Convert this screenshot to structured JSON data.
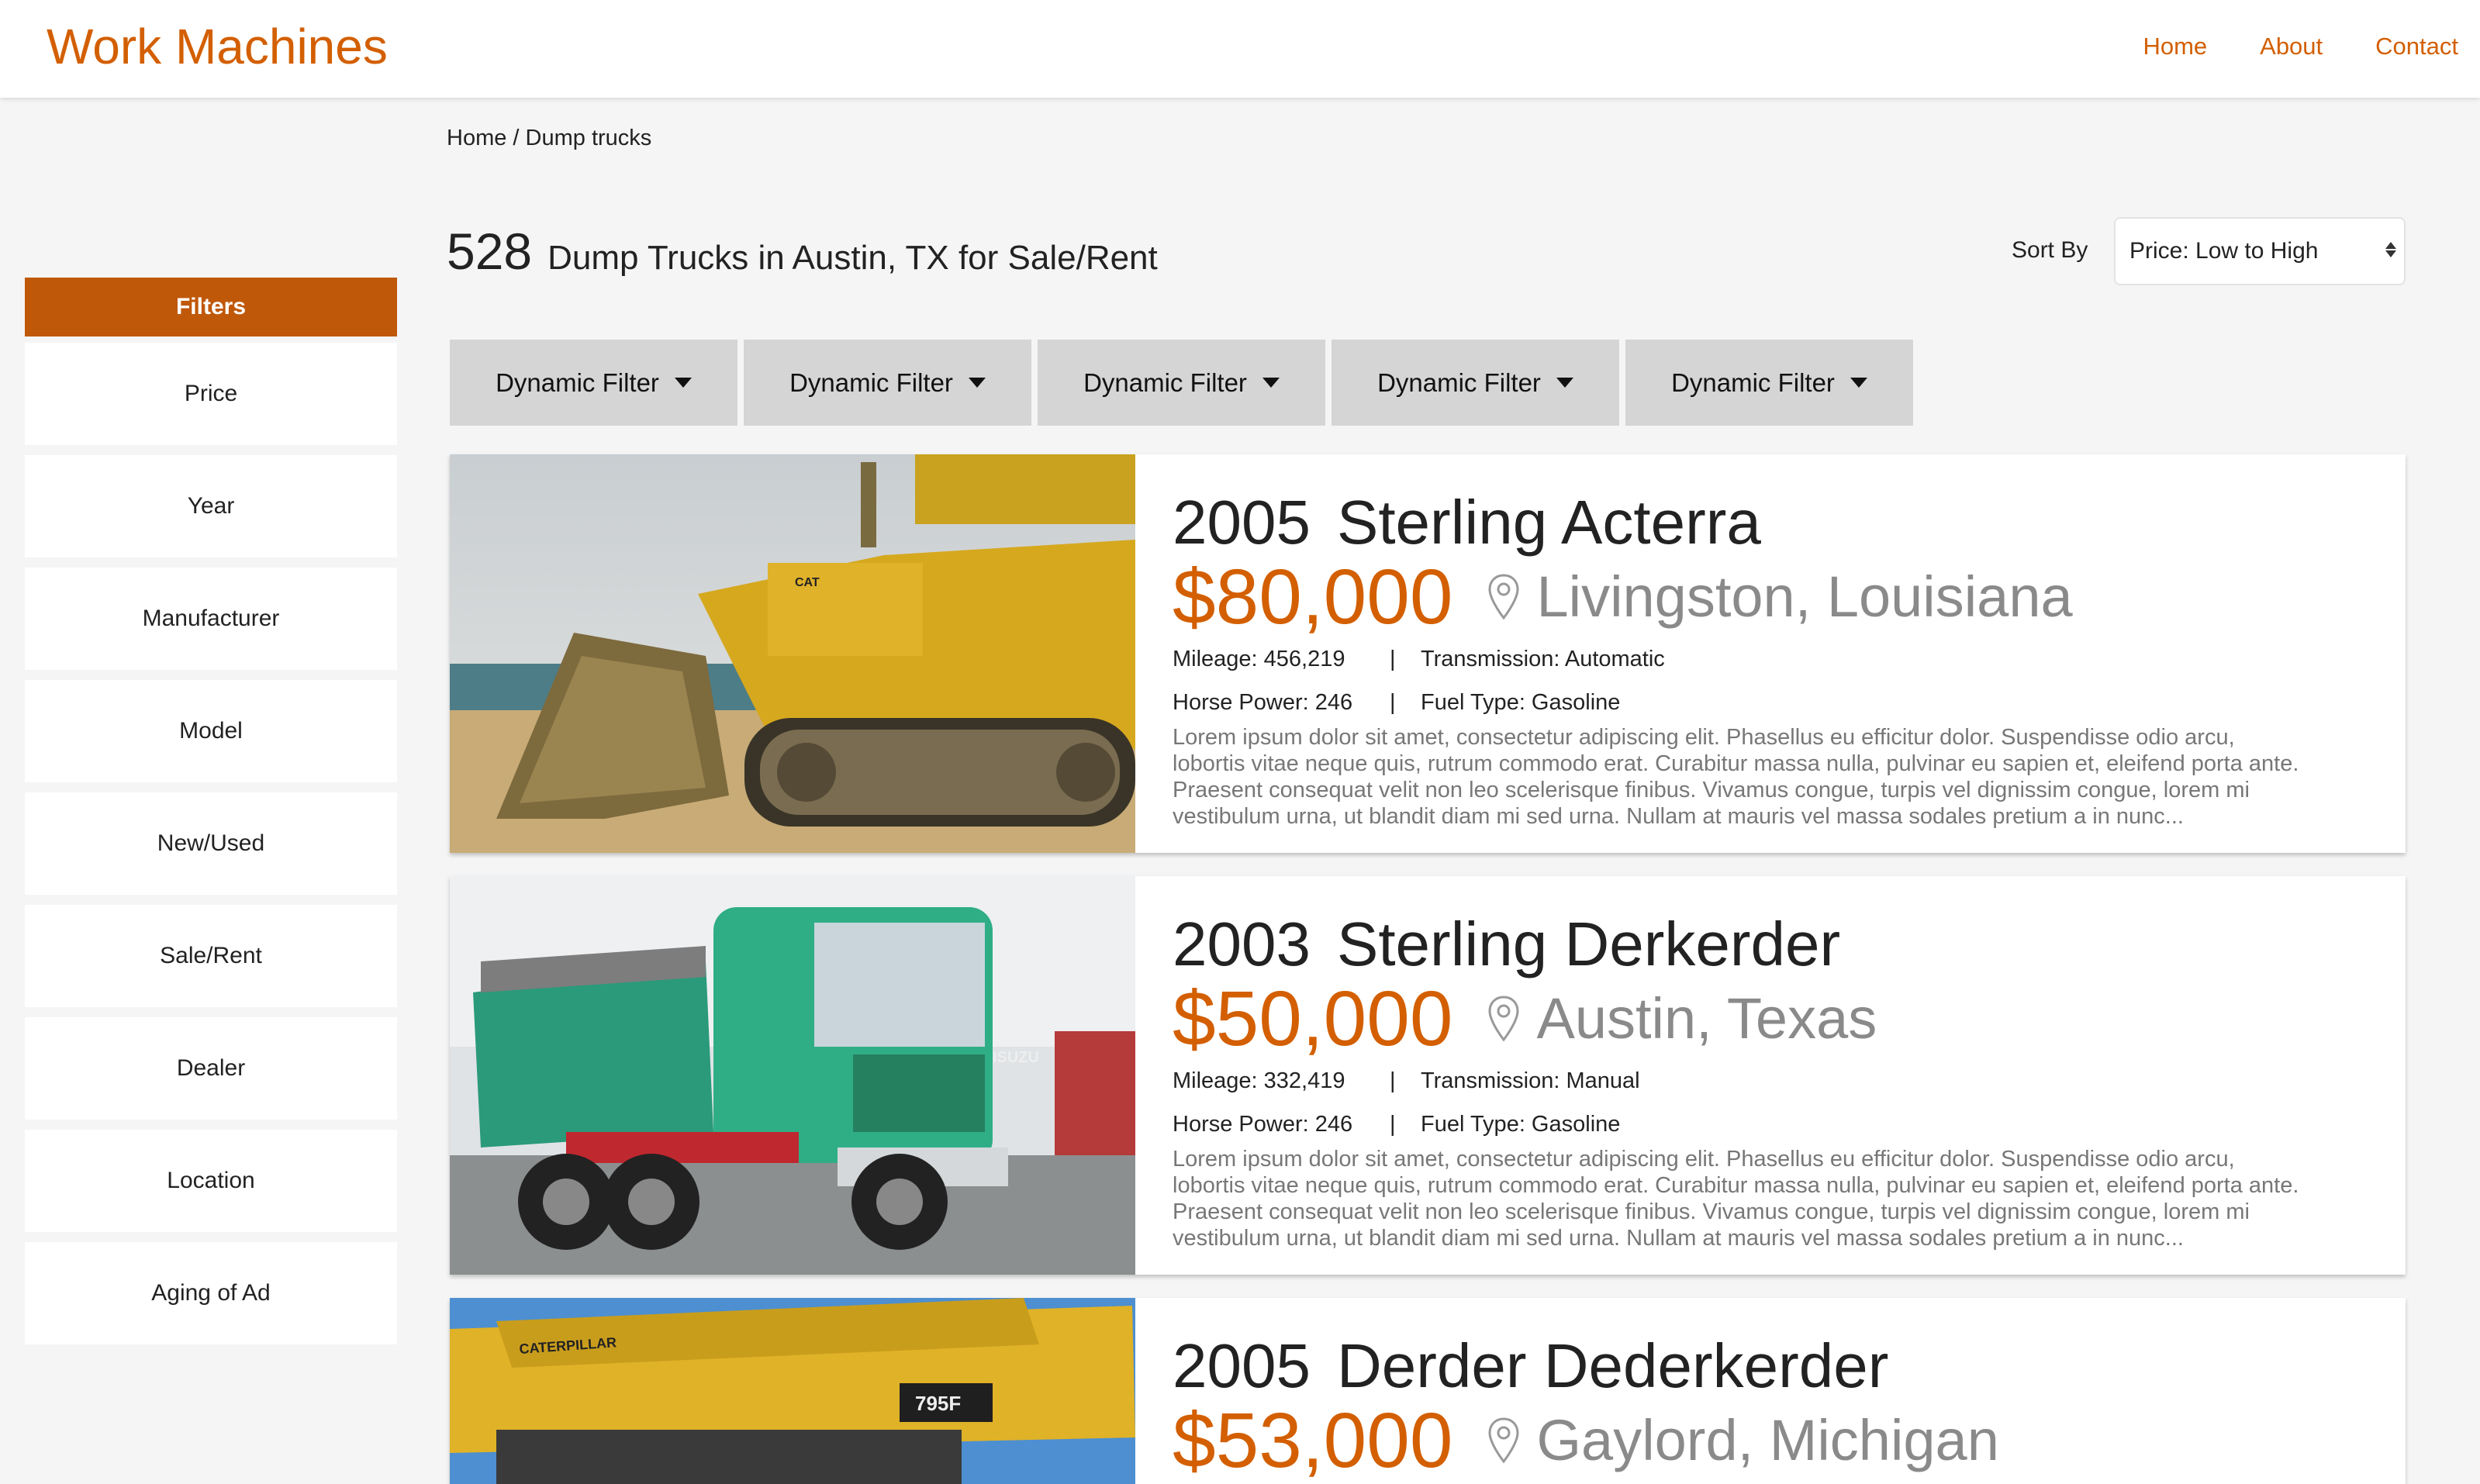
{
  "brand": "Work Machines",
  "nav": {
    "home": "Home",
    "about": "About",
    "contact": "Contact"
  },
  "breadcrumb": "Home / Dump trucks",
  "results": {
    "count": "528",
    "title": "Dump Trucks in Austin, TX for Sale/Rent"
  },
  "sort": {
    "label": "Sort By",
    "value": "Price: Low to High"
  },
  "filters": {
    "header": "Filters",
    "items": [
      "Price",
      "Year",
      "Manufacturer",
      "Model",
      "New/Used",
      "Sale/Rent",
      "Dealer",
      "Location",
      "Aging of Ad"
    ]
  },
  "dynamic_filters": [
    "Dynamic Filter",
    "Dynamic Filter",
    "Dynamic Filter",
    "Dynamic Filter",
    "Dynamic Filter"
  ],
  "listings": [
    {
      "year": "2005",
      "name": "Sterling Acterra",
      "price": "$80,000",
      "location": "Livingston, Louisiana",
      "mileage": "Mileage: 456,219",
      "transmission": "Transmission: Automatic",
      "horsepower": "Horse Power: 246",
      "fuel": "Fuel Type: Gasoline",
      "sep": "|",
      "description": "Lorem ipsum dolor sit amet, consectetur adipiscing elit. Phasellus eu efficitur dolor. Suspendisse odio arcu, lobortis vitae neque quis, rutrum commodo erat. Curabitur massa nulla, pulvinar eu sapien et, eleifend porta ante. Praesent consequat velit non leo scelerisque finibus. Vivamus congue, turpis vel dignissim congue, lorem mi vestibulum urna, ut blandit diam mi sed urna. Nullam at mauris vel massa sodales pretium a in nunc...",
      "image_text": "CAT"
    },
    {
      "year": "2003",
      "name": "Sterling Derkerder",
      "price": "$50,000",
      "location": "Austin, Texas",
      "mileage": "Mileage: 332,419",
      "transmission": "Transmission: Manual",
      "horsepower": "Horse Power: 246",
      "fuel": "Fuel Type: Gasoline",
      "sep": "|",
      "description": "Lorem ipsum dolor sit amet, consectetur adipiscing elit. Phasellus eu efficitur dolor. Suspendisse odio arcu, lobortis vitae neque quis, rutrum commodo erat. Curabitur massa nulla, pulvinar eu sapien et, eleifend porta ante. Praesent consequat velit non leo scelerisque finibus. Vivamus congue, turpis vel dignissim congue, lorem mi vestibulum urna, ut blandit diam mi sed urna. Nullam at mauris vel massa sodales pretium a in nunc...",
      "image_text": "ISUZU"
    },
    {
      "year": "2005",
      "name": "Derder Dederkerder",
      "price": "$53,000",
      "location": "Gaylord, Michigan",
      "image_text_1": "CATERPILLAR",
      "image_text_2": "795F"
    }
  ],
  "colors": {
    "accent": "#d35f00",
    "filter_header": "#c0580a",
    "dynamic_filter_bg": "#d5d5d5"
  }
}
